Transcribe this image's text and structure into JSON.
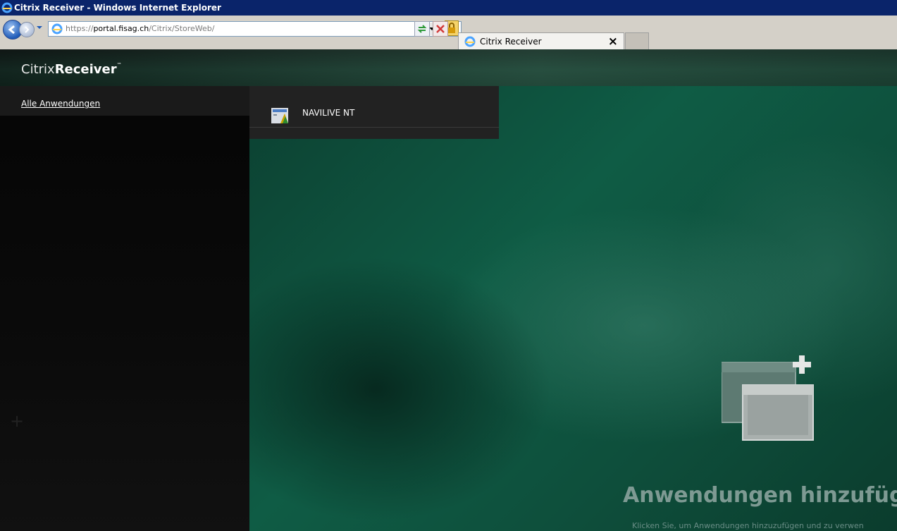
{
  "window": {
    "title": "Citrix Receiver - Windows Internet Explorer"
  },
  "toolbar": {
    "address": {
      "protocol": "https://",
      "domain": "portal.fisag.ch",
      "path": "/Citrix/StoreWeb/"
    },
    "tab": {
      "label": "Citrix Receiver",
      "close": "×"
    }
  },
  "header": {
    "logo_light": "Citrix",
    "logo_bold": "Receiver",
    "logo_tm": "™"
  },
  "sidebar": {
    "link": "Alle Anwendungen",
    "plus": "+"
  },
  "apps": [
    {
      "label": "NAVILIVE NT"
    }
  ],
  "main": {
    "title": "Anwendungen hinzufüge",
    "subtitle": "Klicken Sie, um Anwendungen hinzuzufügen und zu verwen"
  },
  "colors": {
    "titlebar": "#0a246a",
    "accent_green": "#0f5c45"
  }
}
